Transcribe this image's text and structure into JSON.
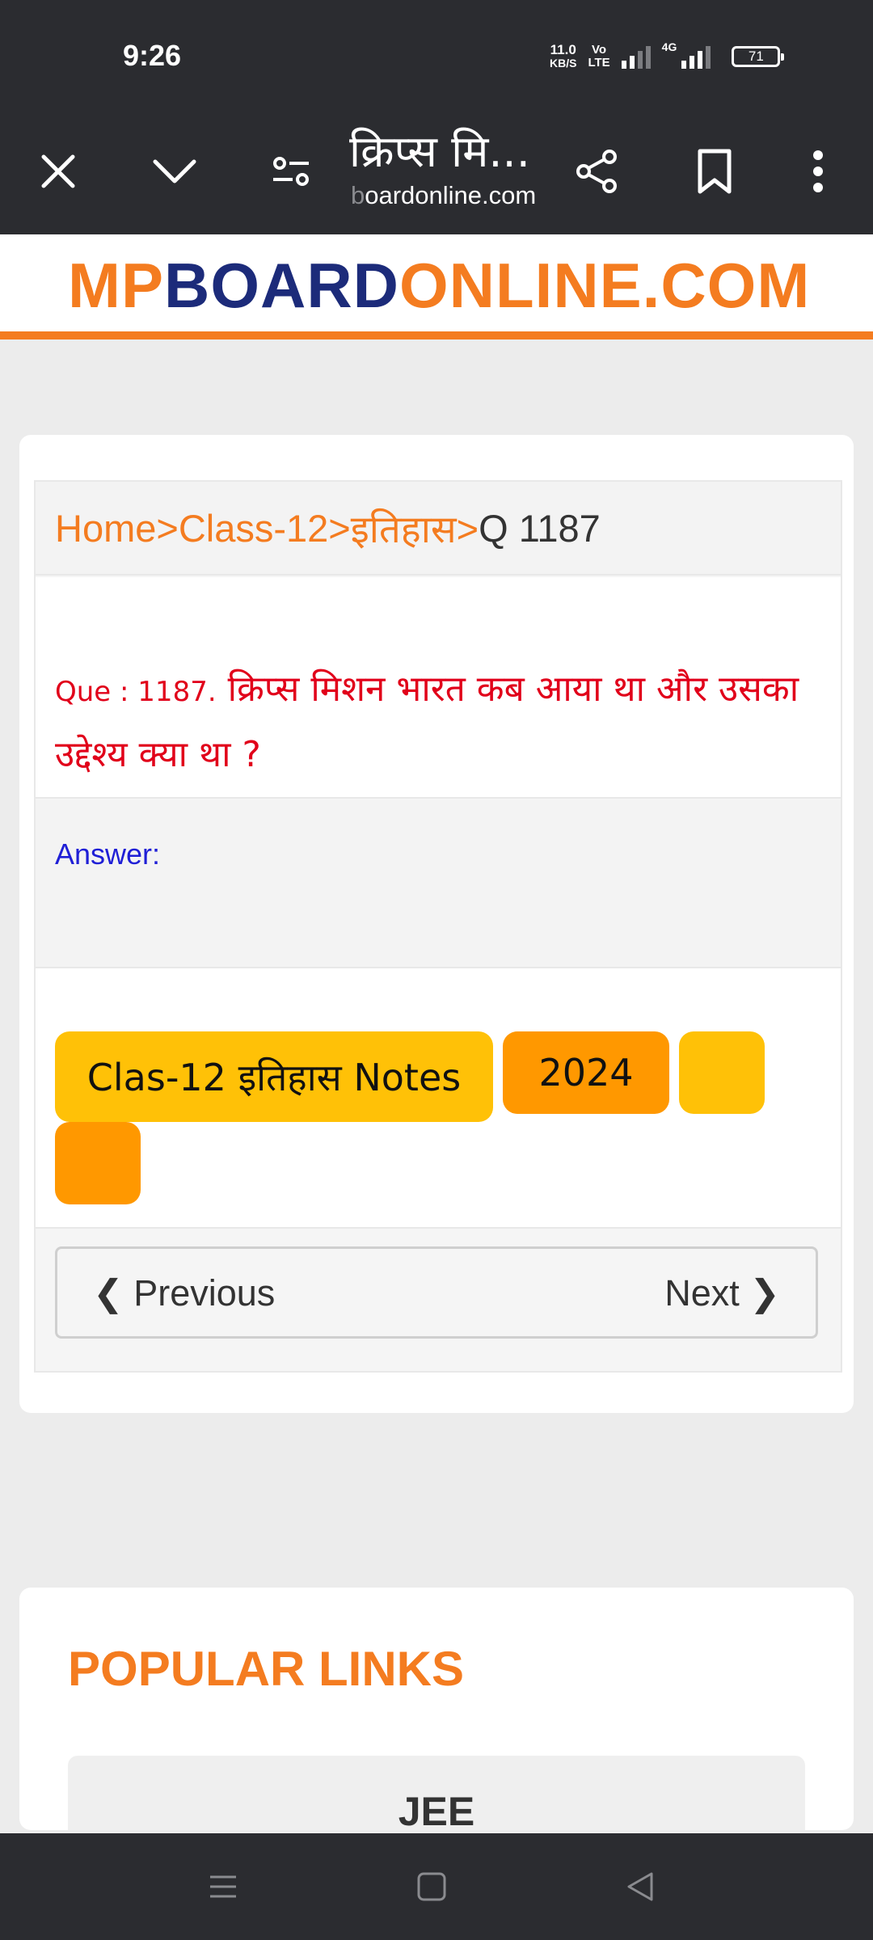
{
  "status_bar": {
    "time": "9:26",
    "net_speed_value": "11.0",
    "net_speed_unit": "KB/S",
    "volte_top": "Vo",
    "volte_bottom": "LTE",
    "network": "4G",
    "battery": "71"
  },
  "browser": {
    "tab_title": "क्रिप्स मि...",
    "url_faded": "b",
    "url": "oardonline.com",
    "icons": [
      "close-icon",
      "chevron-down-icon",
      "filter-icon",
      "share-icon",
      "bookmark-icon",
      "more-vert-icon"
    ]
  },
  "site": {
    "logo_mp": "MP",
    "logo_board": "BOARD",
    "logo_online": "ONLINE.COM"
  },
  "breadcrumb": {
    "home": "Home>",
    "class": " Class-12>",
    "subject": " इतिहास>",
    "current": "Q 1187"
  },
  "question": {
    "label": "Que : 1187.",
    "text": " क्रिप्स मिशन भारत कब आया था और उसका उद्देश्य क्या था ?"
  },
  "answer": {
    "label": "Answer:"
  },
  "tags": [
    {
      "label": "Clas-12 इतिहास Notes",
      "color": "#ffc107"
    },
    {
      "label": "2024",
      "color": "#ff9800"
    },
    {
      "label": "",
      "color": "#ffc107"
    },
    {
      "label": "",
      "color": "#ff9800"
    }
  ],
  "pager": {
    "previous": "❮ Previous",
    "next": "Next ❯"
  },
  "popular": {
    "title": "POPULAR LINKS",
    "items": [
      "JEE"
    ]
  },
  "colors": {
    "brand_orange": "#f47c20",
    "brand_navy": "#1c2b7a",
    "question_red": "#e1001a",
    "answer_blue": "#1f1fd6",
    "chrome_dark": "#2b2c30"
  }
}
